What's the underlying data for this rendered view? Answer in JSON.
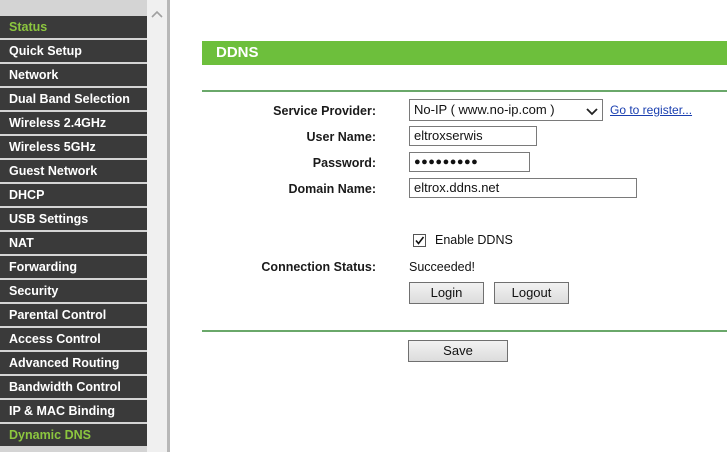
{
  "sidebar": {
    "items": [
      {
        "label": "Status",
        "active": true
      },
      {
        "label": "Quick Setup",
        "active": false
      },
      {
        "label": "Network",
        "active": false
      },
      {
        "label": "Dual Band Selection",
        "active": false
      },
      {
        "label": "Wireless 2.4GHz",
        "active": false
      },
      {
        "label": "Wireless 5GHz",
        "active": false
      },
      {
        "label": "Guest Network",
        "active": false
      },
      {
        "label": "DHCP",
        "active": false
      },
      {
        "label": "USB Settings",
        "active": false
      },
      {
        "label": "NAT",
        "active": false
      },
      {
        "label": "Forwarding",
        "active": false
      },
      {
        "label": "Security",
        "active": false
      },
      {
        "label": "Parental Control",
        "active": false
      },
      {
        "label": "Access Control",
        "active": false
      },
      {
        "label": "Advanced Routing",
        "active": false
      },
      {
        "label": "Bandwidth Control",
        "active": false
      },
      {
        "label": "IP & MAC Binding",
        "active": false
      },
      {
        "label": "Dynamic DNS",
        "active": true
      }
    ]
  },
  "page": {
    "title": "DDNS"
  },
  "form": {
    "service_provider_label": "Service Provider:",
    "service_provider_value": "No-IP ( www.no-ip.com )",
    "register_link": "Go to register...",
    "username_label": "User Name:",
    "username_value": "eltroxserwis",
    "password_label": "Password:",
    "password_value": "●●●●●●●●●",
    "domain_label": "Domain Name:",
    "domain_value": "eltrox.ddns.net",
    "enable_label": "Enable DDNS",
    "enable_checked": true,
    "connection_status_label": "Connection Status:",
    "connection_status_value": "Succeeded!",
    "login_button": "Login",
    "logout_button": "Logout",
    "save_button": "Save"
  },
  "colors": {
    "accent_green": "#6dbf3c",
    "active_nav_text": "#8cc63f",
    "nav_background": "#3a3a3a",
    "link_blue": "#1a3fb0"
  }
}
